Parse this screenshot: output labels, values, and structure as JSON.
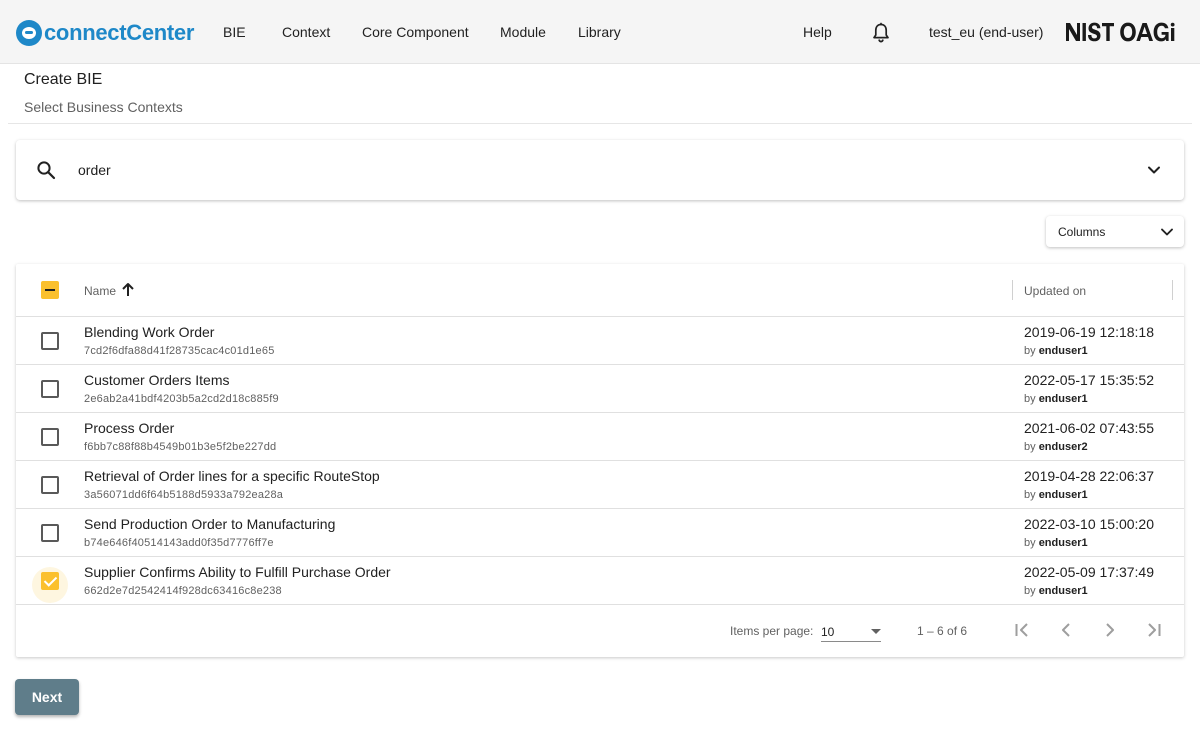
{
  "header": {
    "logo_text": "connectCenter",
    "nav": [
      "BIE",
      "Context",
      "Core Component",
      "Module",
      "Library"
    ],
    "help": "Help",
    "user": "test_eu (end-user)",
    "org_logo_text": "NIST OAGi"
  },
  "page": {
    "title": "Create BIE",
    "subtitle": "Select Business Contexts"
  },
  "search": {
    "value": "order",
    "placeholder": ""
  },
  "columns_button": "Columns",
  "table": {
    "headers": {
      "name": "Name",
      "updated_on": "Updated on"
    },
    "sort": {
      "column": "Name",
      "direction": "ascending"
    },
    "select_all_state": "indeterminate",
    "rows": [
      {
        "name": "Blending Work Order",
        "guid": "7cd2f6dfa88d41f28735cac4c01d1e65",
        "updated": "2019-06-19 12:18:18",
        "by_prefix": "by",
        "user": "enduser1",
        "checked": false
      },
      {
        "name": "Customer Orders Items",
        "guid": "2e6ab2a41bdf4203b5a2cd2d18c885f9",
        "updated": "2022-05-17 15:35:52",
        "by_prefix": "by",
        "user": "enduser1",
        "checked": false
      },
      {
        "name": "Process Order",
        "guid": "f6bb7c88f88b4549b01b3e5f2be227dd",
        "updated": "2021-06-02 07:43:55",
        "by_prefix": "by",
        "user": "enduser2",
        "checked": false
      },
      {
        "name": "Retrieval of Order lines for a specific RouteStop",
        "guid": "3a56071dd6f64b5188d5933a792ea28a",
        "updated": "2019-04-28 22:06:37",
        "by_prefix": "by",
        "user": "enduser1",
        "checked": false
      },
      {
        "name": "Send Production Order to Manufacturing",
        "guid": "b74e646f40514143add0f35d7776ff7e",
        "updated": "2022-03-10 15:00:20",
        "by_prefix": "by",
        "user": "enduser1",
        "checked": false
      },
      {
        "name": "Supplier Confirms Ability to Fulfill Purchase Order",
        "guid": "662d2e7d2542414f928dc63416c8e238",
        "updated": "2022-05-09 17:37:49",
        "by_prefix": "by",
        "user": "enduser1",
        "checked": true
      }
    ]
  },
  "paginator": {
    "items_per_page_label": "Items per page:",
    "items_per_page": "10",
    "range": "1 – 6 of 6"
  },
  "next_button": "Next",
  "colors": {
    "brand": "#1e88c8",
    "accent": "#fbc02d",
    "next_button": "#5f7d8a",
    "topbar": "#f5f5f5"
  },
  "icons": [
    "bell-icon",
    "search-icon",
    "chevron-down-icon",
    "arrow-up-icon",
    "first-page-icon",
    "prev-page-icon",
    "next-page-icon",
    "last-page-icon"
  ]
}
